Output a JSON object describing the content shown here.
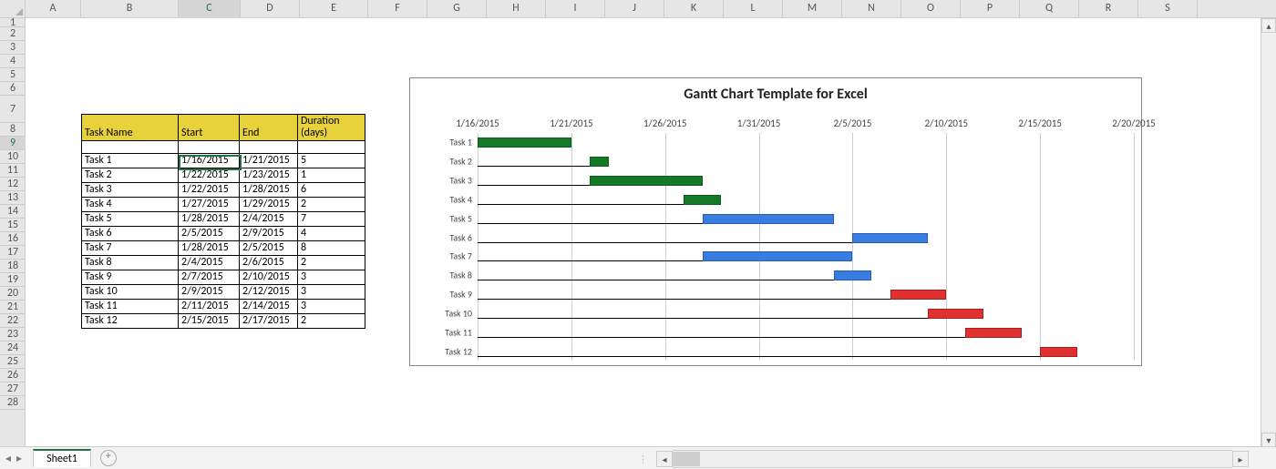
{
  "active_sheet_tab": "Sheet1",
  "selected_cell": "C9",
  "columns": [
    "A",
    "B",
    "C",
    "D",
    "E",
    "F",
    "G",
    "H",
    "I",
    "J",
    "K",
    "L",
    "M",
    "N",
    "O",
    "P",
    "Q",
    "R",
    "S"
  ],
  "table": {
    "headers": [
      "Task Name",
      "Start",
      "End",
      "Duration (days)"
    ],
    "rows": [
      {
        "name": "Task 1",
        "start": "1/16/2015",
        "end": "1/21/2015",
        "duration": "5"
      },
      {
        "name": "Task 2",
        "start": "1/22/2015",
        "end": "1/23/2015",
        "duration": "1"
      },
      {
        "name": "Task 3",
        "start": "1/22/2015",
        "end": "1/28/2015",
        "duration": "6"
      },
      {
        "name": "Task 4",
        "start": "1/27/2015",
        "end": "1/29/2015",
        "duration": "2"
      },
      {
        "name": "Task 5",
        "start": "1/28/2015",
        "end": "2/4/2015",
        "duration": "7"
      },
      {
        "name": "Task 6",
        "start": "2/5/2015",
        "end": "2/9/2015",
        "duration": "4"
      },
      {
        "name": "Task 7",
        "start": "1/28/2015",
        "end": "2/5/2015",
        "duration": "8"
      },
      {
        "name": "Task 8",
        "start": "2/4/2015",
        "end": "2/6/2015",
        "duration": "2"
      },
      {
        "name": "Task 9",
        "start": "2/7/2015",
        "end": "2/10/2015",
        "duration": "3"
      },
      {
        "name": "Task 10",
        "start": "2/9/2015",
        "end": "2/12/2015",
        "duration": "3"
      },
      {
        "name": "Task 11",
        "start": "2/11/2015",
        "end": "2/14/2015",
        "duration": "3"
      },
      {
        "name": "Task 12",
        "start": "2/15/2015",
        "end": "2/17/2015",
        "duration": "2"
      }
    ]
  },
  "chart_data": {
    "type": "bar",
    "title": "Gantt Chart Template for Excel",
    "xlabel": "",
    "ylabel": "",
    "x_axis_dates": [
      "1/16/2015",
      "1/21/2015",
      "1/26/2015",
      "1/31/2015",
      "2/5/2015",
      "2/10/2015",
      "2/15/2015",
      "2/20/2015"
    ],
    "x_min_day": 0,
    "x_max_day": 35,
    "categories": [
      "Task 1",
      "Task 2",
      "Task 3",
      "Task 4",
      "Task 5",
      "Task 6",
      "Task 7",
      "Task 8",
      "Task 9",
      "Task 10",
      "Task 11",
      "Task 12"
    ],
    "series": [
      {
        "name": "Task 1",
        "start_day": 0,
        "duration": 5,
        "color": "green"
      },
      {
        "name": "Task 2",
        "start_day": 6,
        "duration": 1,
        "color": "green"
      },
      {
        "name": "Task 3",
        "start_day": 6,
        "duration": 6,
        "color": "green"
      },
      {
        "name": "Task 4",
        "start_day": 11,
        "duration": 2,
        "color": "green"
      },
      {
        "name": "Task 5",
        "start_day": 12,
        "duration": 7,
        "color": "blue"
      },
      {
        "name": "Task 6",
        "start_day": 20,
        "duration": 4,
        "color": "blue"
      },
      {
        "name": "Task 7",
        "start_day": 12,
        "duration": 8,
        "color": "blue"
      },
      {
        "name": "Task 8",
        "start_day": 19,
        "duration": 2,
        "color": "blue"
      },
      {
        "name": "Task 9",
        "start_day": 22,
        "duration": 3,
        "color": "red"
      },
      {
        "name": "Task 10",
        "start_day": 24,
        "duration": 3,
        "color": "red"
      },
      {
        "name": "Task 11",
        "start_day": 26,
        "duration": 3,
        "color": "red"
      },
      {
        "name": "Task 12",
        "start_day": 30,
        "duration": 2,
        "color": "red"
      }
    ]
  }
}
